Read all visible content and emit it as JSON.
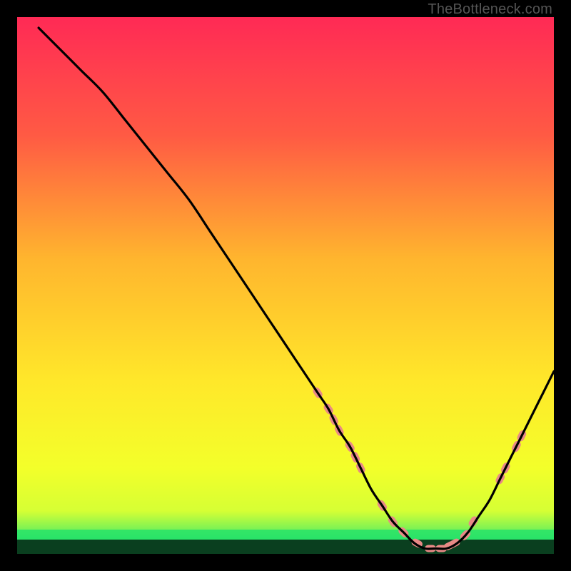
{
  "watermark": "TheBottleneck.com",
  "chart_data": {
    "type": "line",
    "title": "",
    "xlabel": "",
    "ylabel": "",
    "xlim": [
      0,
      100
    ],
    "ylim": [
      0,
      100
    ],
    "grid": false,
    "legend": false,
    "background_gradient": {
      "top": "#ff2a55",
      "mid_upper": "#ff7a3a",
      "mid": "#ffd92a",
      "mid_lower": "#f7ff2a",
      "green_band": "#27e36a",
      "bottom": "#0a3f1f"
    },
    "series": [
      {
        "name": "bottleneck-curve",
        "color": "#000000",
        "x": [
          4,
          8,
          12,
          16,
          20,
          24,
          28,
          32,
          36,
          40,
          44,
          48,
          52,
          56,
          58,
          60,
          62,
          64,
          66,
          68,
          70,
          72,
          74,
          76,
          78,
          80,
          82,
          84,
          86,
          88,
          90,
          92,
          94,
          96,
          98,
          100
        ],
        "y": [
          98,
          94,
          90,
          86,
          81,
          76,
          71,
          66,
          60,
          54,
          48,
          42,
          36,
          30,
          27,
          23,
          20,
          16,
          12,
          9,
          6,
          4,
          2,
          1,
          1,
          1,
          2,
          4,
          7,
          10,
          14,
          18,
          22,
          26,
          30,
          34
        ]
      }
    ],
    "markers": {
      "name": "sample-points",
      "color": "#e88a86",
      "shape": "rounded-dash",
      "points": [
        {
          "x": 56,
          "y": 30
        },
        {
          "x": 58,
          "y": 27
        },
        {
          "x": 59,
          "y": 25
        },
        {
          "x": 60,
          "y": 23
        },
        {
          "x": 62,
          "y": 20
        },
        {
          "x": 63,
          "y": 18
        },
        {
          "x": 64,
          "y": 16
        },
        {
          "x": 68,
          "y": 9
        },
        {
          "x": 70,
          "y": 6
        },
        {
          "x": 72,
          "y": 4
        },
        {
          "x": 74.5,
          "y": 2
        },
        {
          "x": 77,
          "y": 1
        },
        {
          "x": 79,
          "y": 1
        },
        {
          "x": 80.5,
          "y": 1.5
        },
        {
          "x": 81.5,
          "y": 2
        },
        {
          "x": 83.5,
          "y": 3.5
        },
        {
          "x": 85,
          "y": 6
        },
        {
          "x": 90,
          "y": 14
        },
        {
          "x": 91,
          "y": 16
        },
        {
          "x": 93,
          "y": 20
        },
        {
          "x": 94,
          "y": 22
        }
      ]
    }
  }
}
